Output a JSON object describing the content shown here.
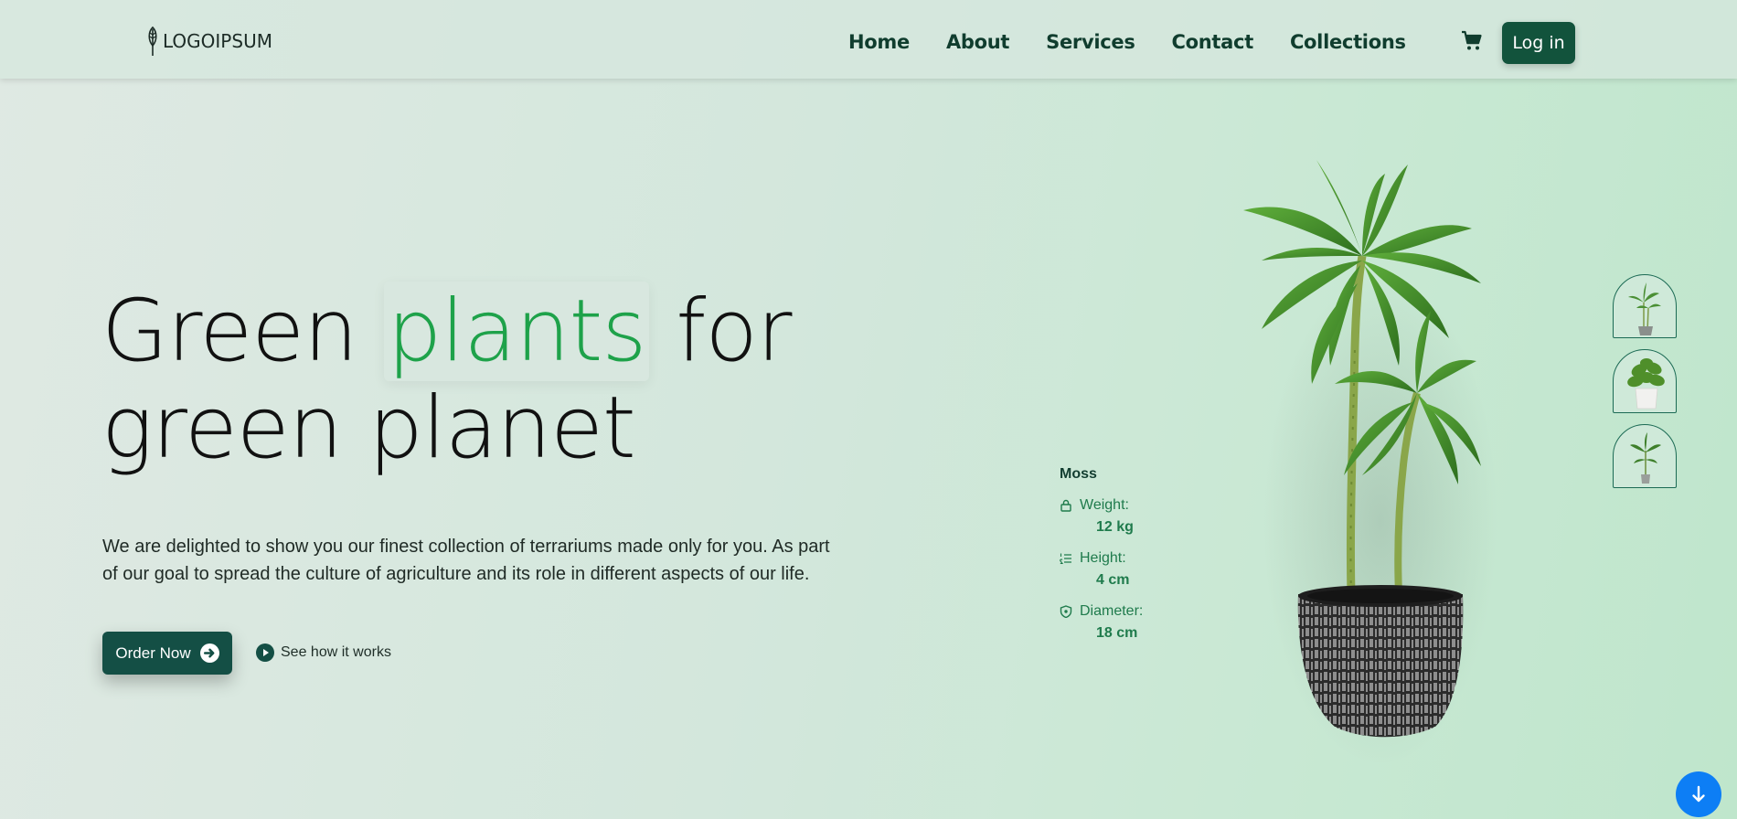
{
  "header": {
    "logo_text": "LOGOIPSUM",
    "nav": [
      "Home",
      "About",
      "Services",
      "Contact",
      "Collections"
    ],
    "login_label": "Log in"
  },
  "hero": {
    "title_word1": "Green",
    "title_highlight": "plants",
    "title_word3": "for",
    "title_line2": "green planet",
    "description": "We are delighted to show you our finest collection of terrariums made only for you. As part of our goal to spread the culture of agriculture and its role in different aspects of our life.",
    "order_label": "Order Now",
    "see_how_label": "See how it works"
  },
  "plant": {
    "name": "Moss",
    "weight_label": "Weight:",
    "weight_value": "12 kg",
    "height_label": "Height:",
    "height_value": "4 cm",
    "diameter_label": "Diameter:",
    "diameter_value": "18 cm"
  },
  "colors": {
    "primary": "#12533c",
    "highlight": "#1ea24a",
    "accent_blue": "#0d7ef5",
    "spec_text": "#1f7b4c"
  },
  "icons": {
    "cart": "cart-icon",
    "arrow": "arrow-right-circle-icon",
    "play": "play-circle-icon",
    "scroll": "arrow-down-icon"
  }
}
